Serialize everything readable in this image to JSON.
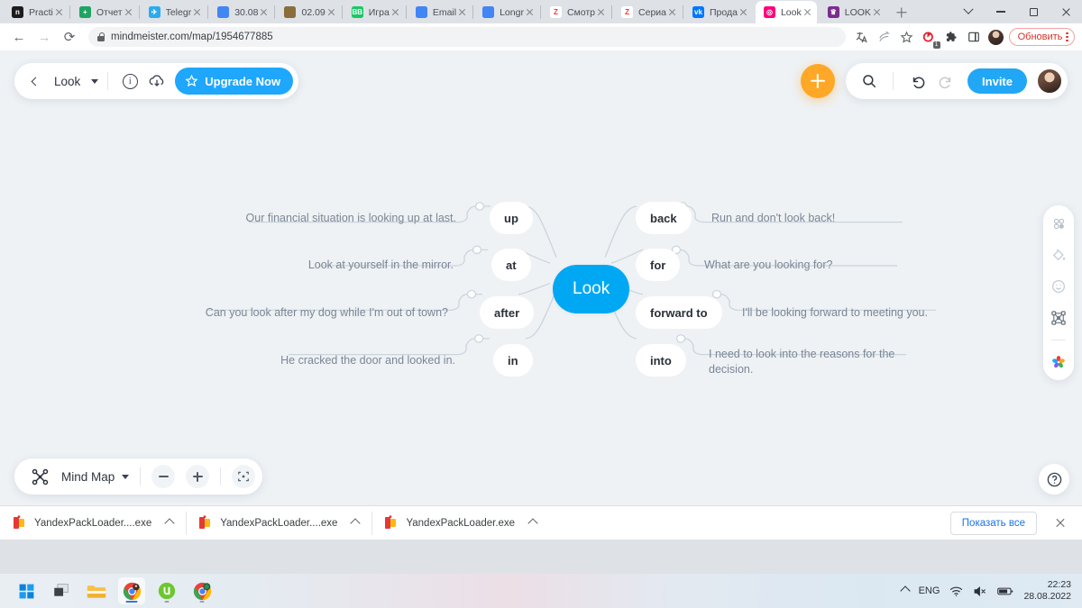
{
  "browser": {
    "tabs": [
      {
        "label": "Practi",
        "fav": "notion-icon",
        "favbg": "#1c1c1c",
        "favtext": "n",
        "active": false
      },
      {
        "label": "Отчет",
        "fav": "sheets-icon",
        "favbg": "#1fa463",
        "favtext": "+",
        "active": false
      },
      {
        "label": "Telegr",
        "fav": "telegram-icon",
        "favbg": "#2aabee",
        "favtext": "✈",
        "active": false
      },
      {
        "label": "30.08",
        "fav": "docs-icon",
        "favbg": "#4285f4",
        "favtext": "",
        "active": false
      },
      {
        "label": "02.09",
        "fav": "docs-icon",
        "favbg": "#8a6d3b",
        "favtext": "",
        "active": false
      },
      {
        "label": "Игра",
        "fav": "vb-icon",
        "favbg": "#17c964",
        "favtext": "BB",
        "active": false
      },
      {
        "label": "Email",
        "fav": "docs-icon",
        "favbg": "#4285f4",
        "favtext": "",
        "active": false
      },
      {
        "label": "Longr",
        "fav": "docs-icon",
        "favbg": "#4285f4",
        "favtext": "",
        "active": false
      },
      {
        "label": "Смотр",
        "fav": "zen-icon",
        "favbg": "#ffffff",
        "favtext": "Z",
        "active": false
      },
      {
        "label": "Сериа",
        "fav": "zen-icon",
        "favbg": "#ffffff",
        "favtext": "Z",
        "active": false
      },
      {
        "label": "Прода",
        "fav": "vk-icon",
        "favbg": "#0077ff",
        "favtext": "vk",
        "active": false
      },
      {
        "label": "Look",
        "fav": "mindmeister-icon",
        "favbg": "#ff0080",
        "favtext": "◎",
        "active": true
      },
      {
        "label": "LOOK",
        "fav": "crown-icon",
        "favbg": "#7b2d8e",
        "favtext": "♛",
        "active": false
      }
    ],
    "newtab_label": "+",
    "toolbar": {
      "back": "←",
      "forward": "→",
      "reload": "⟳",
      "url": "mindmeister.com/map/1954677885",
      "translate_icon": "translate-icon",
      "share_icon": "share-icon",
      "bookmark_icon": "star-icon",
      "extension_badge": "1",
      "update_label": "Обновить"
    }
  },
  "app": {
    "toolbar_left": {
      "back_label": "‹",
      "map_title": "Look",
      "info_icon": "i",
      "download_icon": "download-cloud-icon",
      "upgrade_label": "Upgrade Now"
    },
    "toolbar_right": {
      "add_label": "+",
      "search_icon": "search-icon",
      "undo_icon": "undo-icon",
      "redo_icon": "redo-icon",
      "invite_label": "Invite"
    },
    "side_tools": [
      {
        "name": "layout-icon"
      },
      {
        "name": "paint-bucket-icon"
      },
      {
        "name": "emoji-icon"
      },
      {
        "name": "topic-icon"
      },
      {
        "name": "theme-palette-icon"
      }
    ],
    "bottom_bar": {
      "view_label": "Mind Map",
      "zoom_out": "−",
      "zoom_in": "+",
      "fit_icon": "fit-screen-icon"
    },
    "help_label": "?"
  },
  "mindmap": {
    "root": "Look",
    "left_branches": [
      {
        "node": "up",
        "text": "Our financial situation is looking up at last."
      },
      {
        "node": "at",
        "text": "Look at yourself in the mirror."
      },
      {
        "node": "after",
        "text": "Can you look after my dog while I'm out of town?"
      },
      {
        "node": "in",
        "text": "He cracked the door and looked in."
      }
    ],
    "right_branches": [
      {
        "node": "back",
        "text": "Run and don't look back!"
      },
      {
        "node": "for",
        "text": "What are you looking for?"
      },
      {
        "node": "forward to",
        "text": "I'll be looking forward to meeting you."
      },
      {
        "node": "into",
        "text": "I need to look into the reasons for the decision."
      }
    ]
  },
  "downloads": {
    "items": [
      {
        "name": "YandexPackLoader....exe"
      },
      {
        "name": "YandexPackLoader....exe"
      },
      {
        "name": "YandexPackLoader.exe"
      }
    ],
    "show_all_label": "Показать все",
    "close_label": "×"
  },
  "taskbar": {
    "apps": [
      {
        "name": "start-button"
      },
      {
        "name": "task-view-button"
      },
      {
        "name": "file-explorer-button"
      },
      {
        "name": "chrome-button"
      },
      {
        "name": "utorrent-button"
      },
      {
        "name": "chrome-secondary-button"
      }
    ],
    "tray": {
      "overflow": "^",
      "language": "ENG",
      "wifi_icon": "wifi-icon",
      "volume_icon": "volume-muted-icon",
      "battery_icon": "battery-icon",
      "time": "22:23",
      "date": "28.08.2022"
    }
  },
  "colors": {
    "accent_blue": "#00a8f3",
    "upgrade_blue": "#1ea7fd",
    "add_orange": "#ffa726",
    "canvas": "#eef2f5",
    "link_gray": "#c9d2da",
    "update_red": "#d93025"
  }
}
